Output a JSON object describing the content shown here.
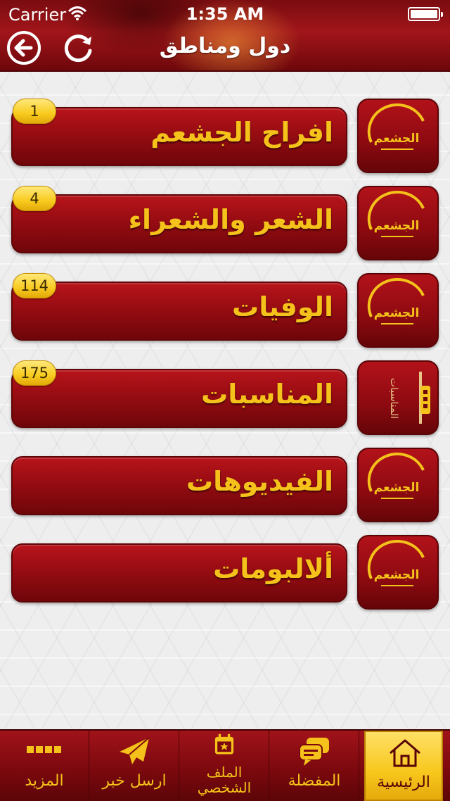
{
  "status_bar": {
    "carrier": "Carrier",
    "time": "1:35 AM"
  },
  "header": {
    "title": "دول ومناطق"
  },
  "categories": [
    {
      "label": "افراح الجشعم",
      "count": "1",
      "thumb": "logo"
    },
    {
      "label": "الشعر والشعراء",
      "count": "4",
      "thumb": "logo"
    },
    {
      "label": "الوفيات",
      "count": "114",
      "thumb": "logo"
    },
    {
      "label": "المناسبات",
      "count": "175",
      "thumb": "occasions"
    },
    {
      "label": "الفيديوهات",
      "count": "",
      "thumb": "logo"
    },
    {
      "label": "ألالبومات",
      "count": "",
      "thumb": "logo"
    }
  ],
  "thumb_text": {
    "logo": "الجشعم",
    "occasions": "المناسبات"
  },
  "tab_bar": {
    "more": "المزيد",
    "send_news": "ارسل خبر",
    "profile_line1": "الملف",
    "profile_line2": "الشخصي",
    "favorites": "المفضلة",
    "home": "الرئيسية"
  },
  "colors": {
    "primary": "#9a0d13",
    "accent": "#f4c21a",
    "badge": "#f8cb1e"
  },
  "icons": [
    "back-arrow-icon",
    "refresh-icon",
    "grid-icon",
    "paper-plane-icon",
    "calendar-icon",
    "chat-bubbles-icon",
    "home-icon"
  ]
}
